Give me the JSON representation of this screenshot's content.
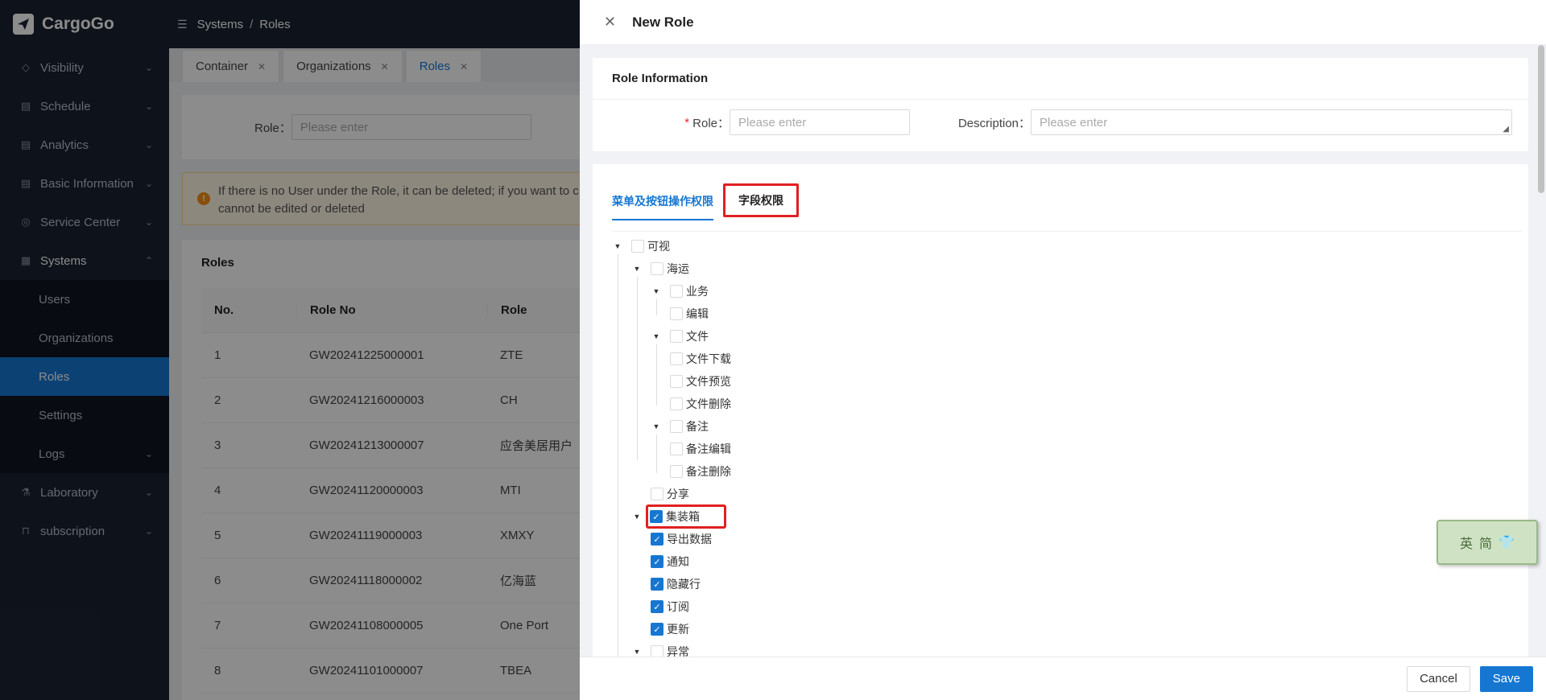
{
  "app": {
    "name": "CargoGo"
  },
  "breadcrumb": {
    "parent": "Systems",
    "current": "Roles"
  },
  "sidebar": {
    "items": [
      {
        "label": "Visibility"
      },
      {
        "label": "Schedule"
      },
      {
        "label": "Analytics"
      },
      {
        "label": "Basic Information"
      },
      {
        "label": "Service Center"
      },
      {
        "label": "Systems"
      },
      {
        "label": "Laboratory"
      },
      {
        "label": "subscription"
      }
    ],
    "sub_items": [
      {
        "label": "Users"
      },
      {
        "label": "Organizations"
      },
      {
        "label": "Roles"
      },
      {
        "label": "Settings"
      },
      {
        "label": "Logs"
      }
    ]
  },
  "tabs": [
    {
      "label": "Container"
    },
    {
      "label": "Organizations"
    },
    {
      "label": "Roles"
    }
  ],
  "search": {
    "role_label": "Role：",
    "role_placeholder": "Please enter"
  },
  "alert": {
    "text": "If there is no User under the Role, it can be deleted; if you want to c",
    "text2": "cannot be edited or deleted"
  },
  "table": {
    "title": "Roles",
    "headers": [
      "No.",
      "Role No",
      "Role"
    ],
    "rows": [
      {
        "no": "1",
        "role_no": "GW20241225000001",
        "role": "ZTE"
      },
      {
        "no": "2",
        "role_no": "GW20241216000003",
        "role": "CH"
      },
      {
        "no": "3",
        "role_no": "GW20241213000007",
        "role": "应舍美居用户"
      },
      {
        "no": "4",
        "role_no": "GW20241120000003",
        "role": "MTI"
      },
      {
        "no": "5",
        "role_no": "GW20241119000003",
        "role": "XMXY"
      },
      {
        "no": "6",
        "role_no": "GW20241118000002",
        "role": "亿海蓝"
      },
      {
        "no": "7",
        "role_no": "GW20241108000005",
        "role": "One Port"
      },
      {
        "no": "8",
        "role_no": "GW20241101000007",
        "role": "TBEA"
      }
    ]
  },
  "drawer": {
    "title": "New Role",
    "info_title": "Role Information",
    "role_label": "Role：",
    "role_placeholder": "Please enter",
    "desc_label": "Description：",
    "desc_placeholder": "Please enter",
    "perm_tabs": [
      "菜单及按钮操作权限",
      "字段权限"
    ],
    "cancel_label": "Cancel",
    "save_label": "Save"
  },
  "tree": [
    {
      "label": "可视",
      "checked": false
    },
    {
      "label": "海运",
      "checked": false
    },
    {
      "label": "业务",
      "checked": false
    },
    {
      "label": "编辑",
      "checked": false
    },
    {
      "label": "文件",
      "checked": false
    },
    {
      "label": "文件下载",
      "checked": false
    },
    {
      "label": "文件预览",
      "checked": false
    },
    {
      "label": "文件删除",
      "checked": false
    },
    {
      "label": "备注",
      "checked": false
    },
    {
      "label": "备注编辑",
      "checked": false
    },
    {
      "label": "备注删除",
      "checked": false
    },
    {
      "label": "分享",
      "checked": false
    },
    {
      "label": "集装箱",
      "checked": true
    },
    {
      "label": "导出数据",
      "checked": true
    },
    {
      "label": "通知",
      "checked": true
    },
    {
      "label": "隐藏行",
      "checked": true
    },
    {
      "label": "订阅",
      "checked": true
    },
    {
      "label": "更新",
      "checked": true
    },
    {
      "label": "异常",
      "checked": false
    }
  ],
  "widget": {
    "text": "英简"
  },
  "colors": {
    "sidebar_bg": "#1b2332",
    "accent": "#1677d2",
    "highlight": "#e02020"
  }
}
